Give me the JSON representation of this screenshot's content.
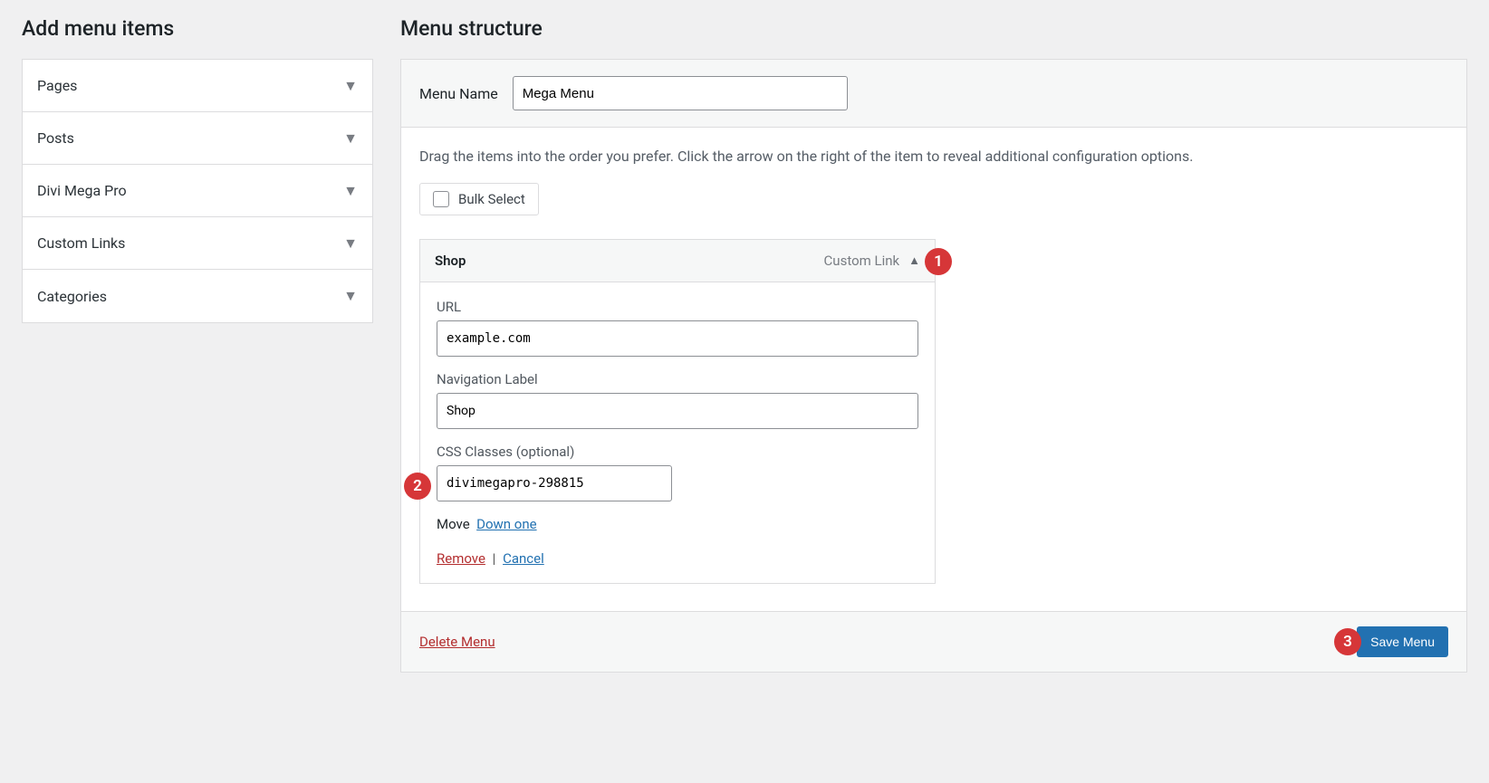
{
  "left": {
    "heading": "Add menu items",
    "items": [
      "Pages",
      "Posts",
      "Divi Mega Pro",
      "Custom Links",
      "Categories"
    ]
  },
  "right": {
    "heading": "Menu structure",
    "menuNameLabel": "Menu Name",
    "menuNameValue": "Mega Menu",
    "instructions": "Drag the items into the order you prefer. Click the arrow on the right of the item to reveal additional configuration options.",
    "bulkSelect": "Bulk Select",
    "item": {
      "title": "Shop",
      "type": "Custom Link",
      "url": {
        "label": "URL",
        "value": "example.com"
      },
      "navLabel": {
        "label": "Navigation Label",
        "value": "Shop"
      },
      "cssClasses": {
        "label": "CSS Classes (optional)",
        "value": "divimegapro-298815"
      },
      "move": {
        "label": "Move",
        "down": "Down one"
      },
      "remove": "Remove",
      "cancel": "Cancel"
    },
    "deleteMenu": "Delete Menu",
    "saveMenu": "Save Menu"
  },
  "badges": {
    "one": "1",
    "two": "2",
    "three": "3"
  }
}
